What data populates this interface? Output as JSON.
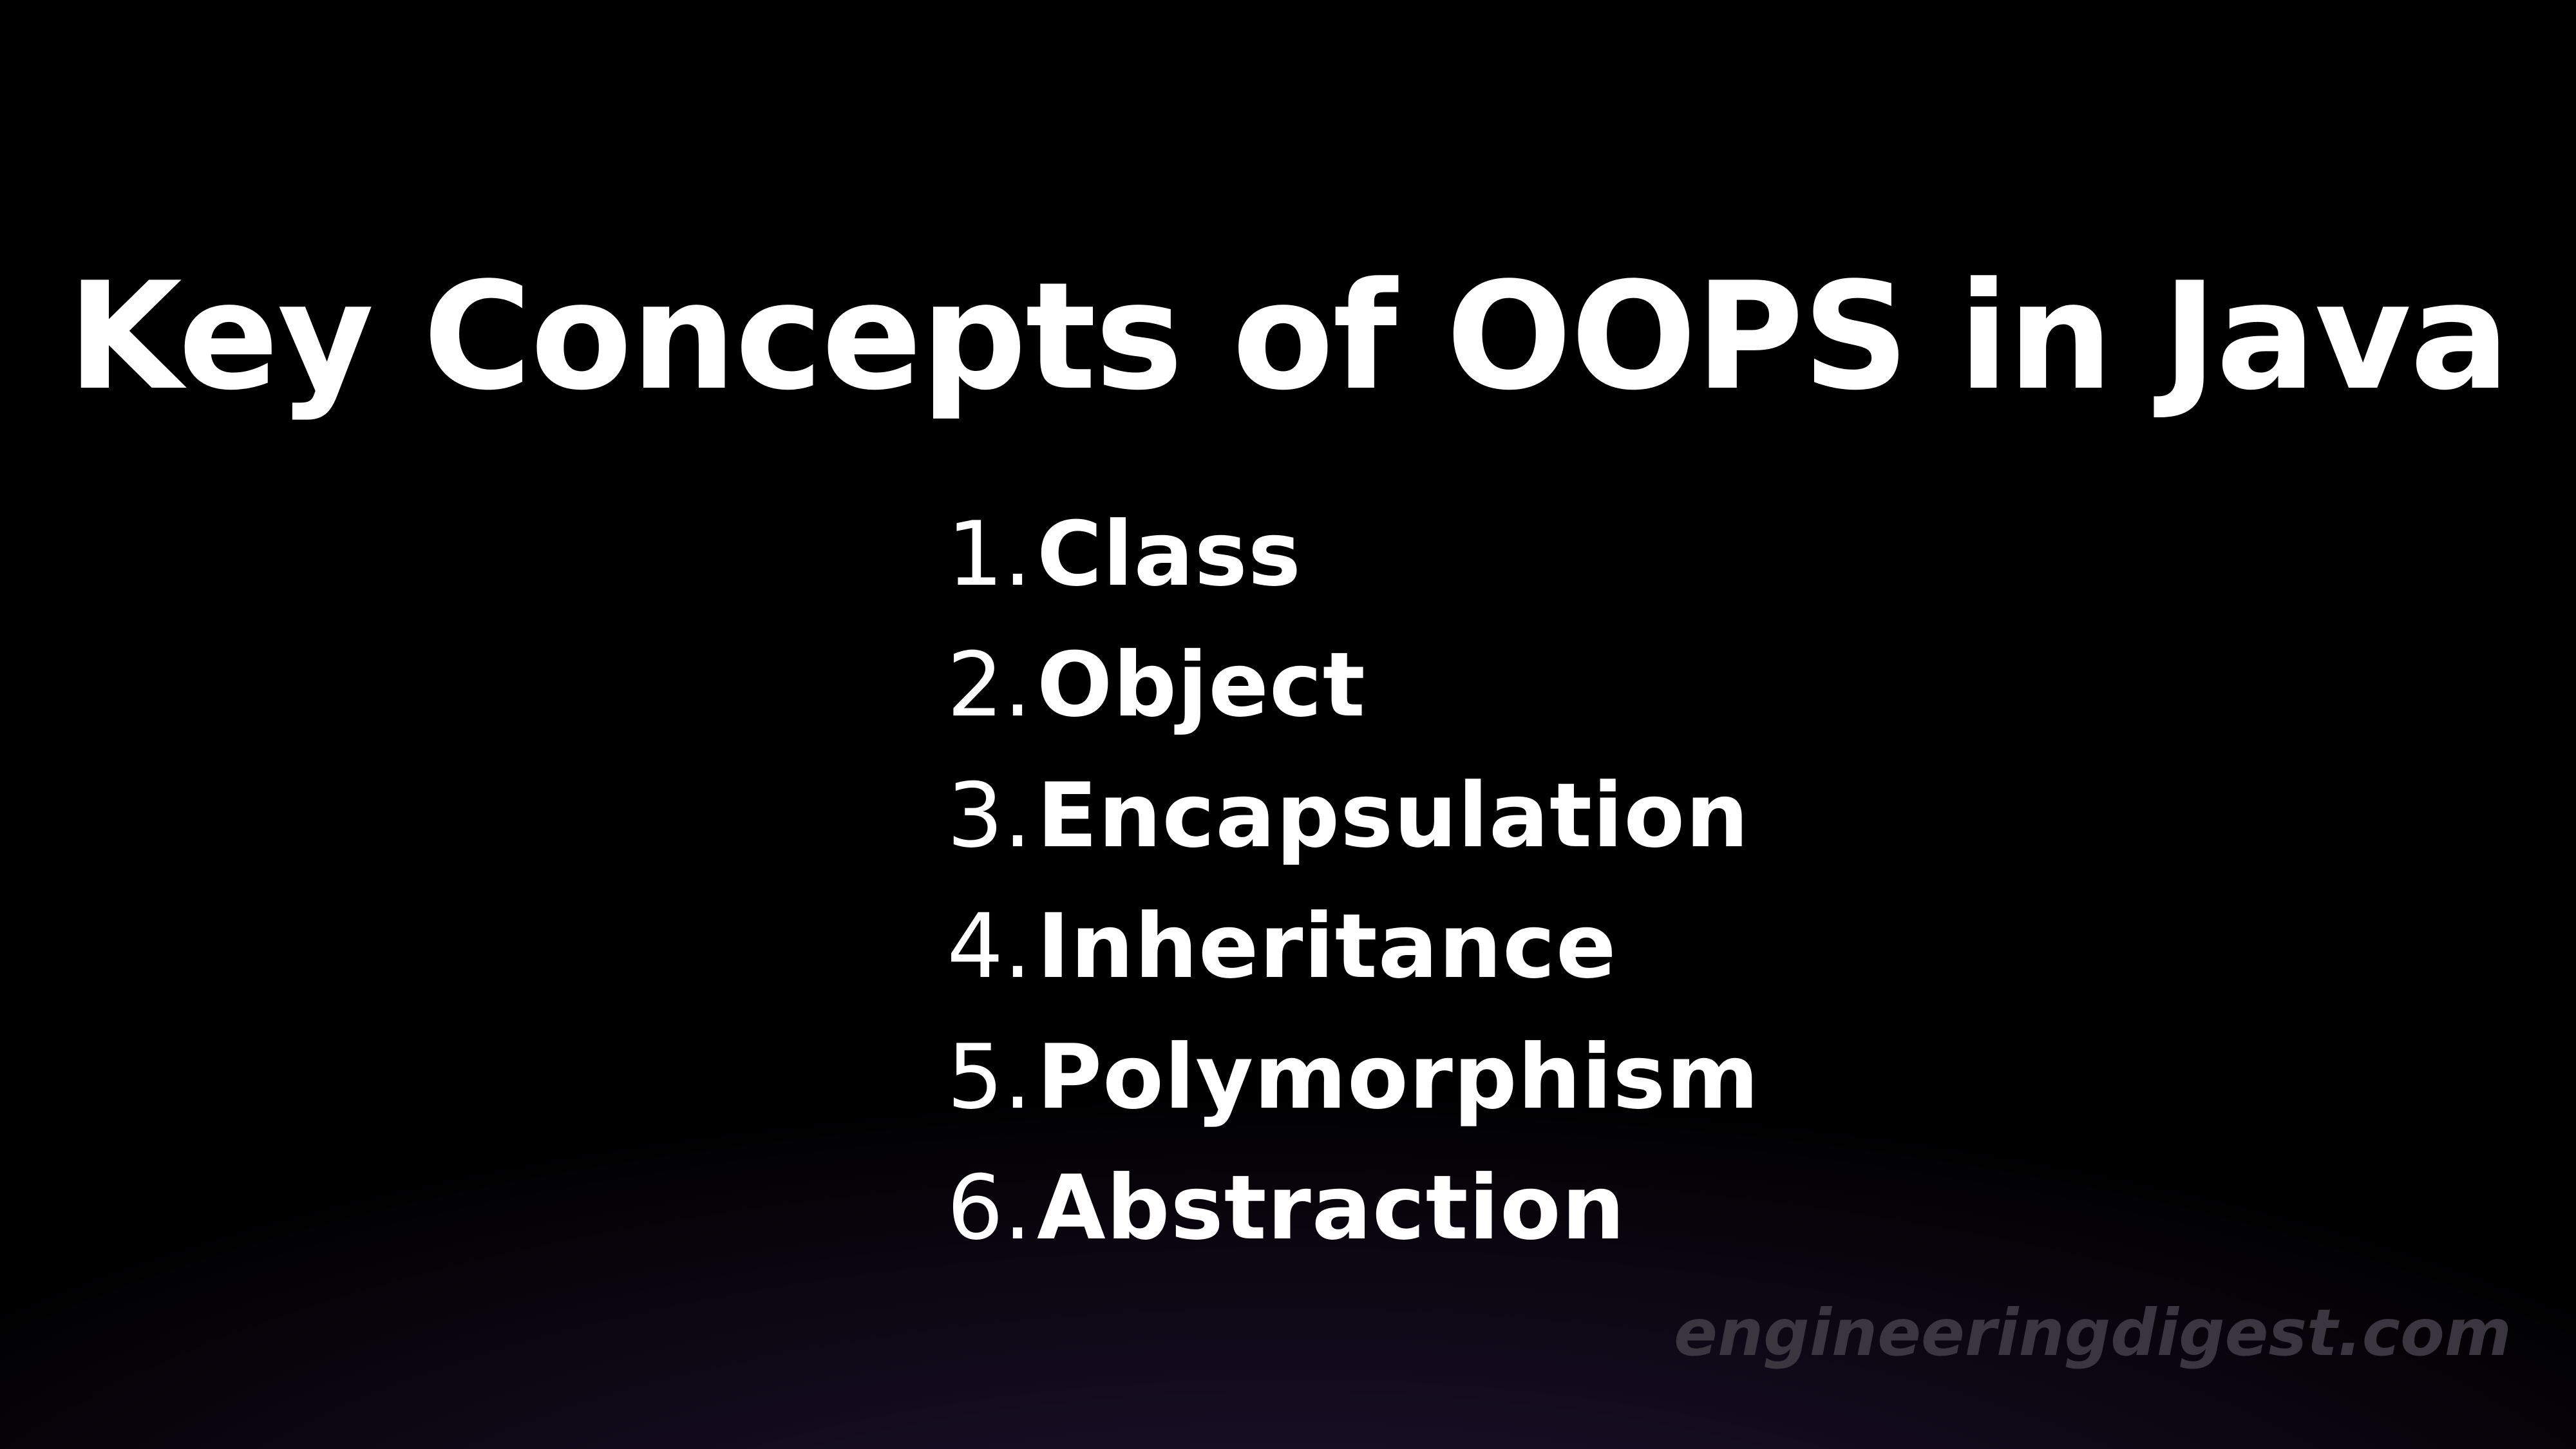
{
  "slide": {
    "title": "Key Concepts of OOPS in Java",
    "concepts": [
      {
        "number": "1.",
        "label": "Class"
      },
      {
        "number": "2.",
        "label": "Object"
      },
      {
        "number": "3.",
        "label": "Encapsulation"
      },
      {
        "number": "4.",
        "label": "Inheritance"
      },
      {
        "number": "5.",
        "label": "Polymorphism"
      },
      {
        "number": "6.",
        "label": "Abstraction"
      }
    ],
    "watermark": "engineeringdigest.com"
  },
  "colors": {
    "background": "#000000",
    "glow": "#231534",
    "text": "#ffffff",
    "watermark": "#3a3640"
  }
}
